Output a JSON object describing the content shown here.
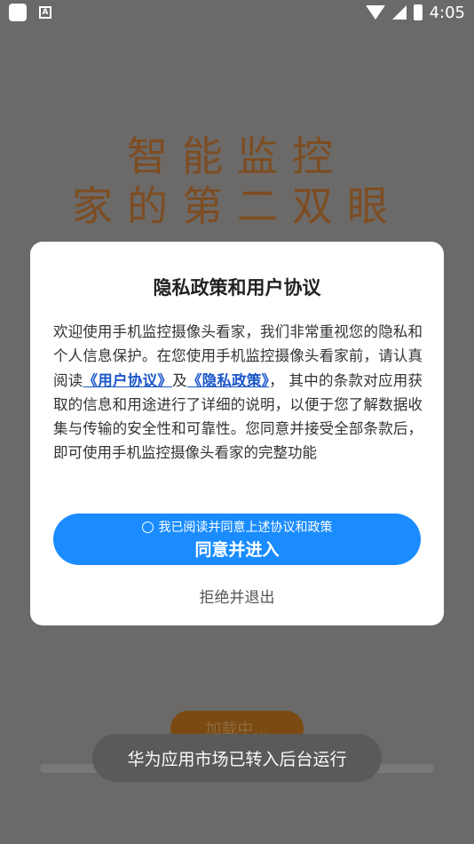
{
  "status_bar": {
    "time": "4:05"
  },
  "splash": {
    "line1": "智能监控",
    "line2": "家的第二双眼",
    "loading": "加载中..."
  },
  "dialog": {
    "title": "隐私政策和用户协议",
    "body_part1": "欢迎使用手机监控摄像头看家，我们非常重视您的隐私和个人信息保护。在您使用手机监控摄像头看家前，请认真阅读",
    "link_user": "《用户协议》",
    "body_and": "及",
    "link_privacy": "《隐私政策》",
    "body_part2": "， 其中的条款对应用获取的信息和用途进行了详细的说明，以便于您了解数据收集与传输的安全性和可靠性。您同意并接受全部条款后，即可使用手机监控摄像头看家的完整功能",
    "agree_check_label": "我已阅读并同意上述协议和政策",
    "agree_button": "同意并进入",
    "reject_button": "拒绝并退出"
  },
  "toast": {
    "text": "华为应用市场已转入后台运行"
  }
}
